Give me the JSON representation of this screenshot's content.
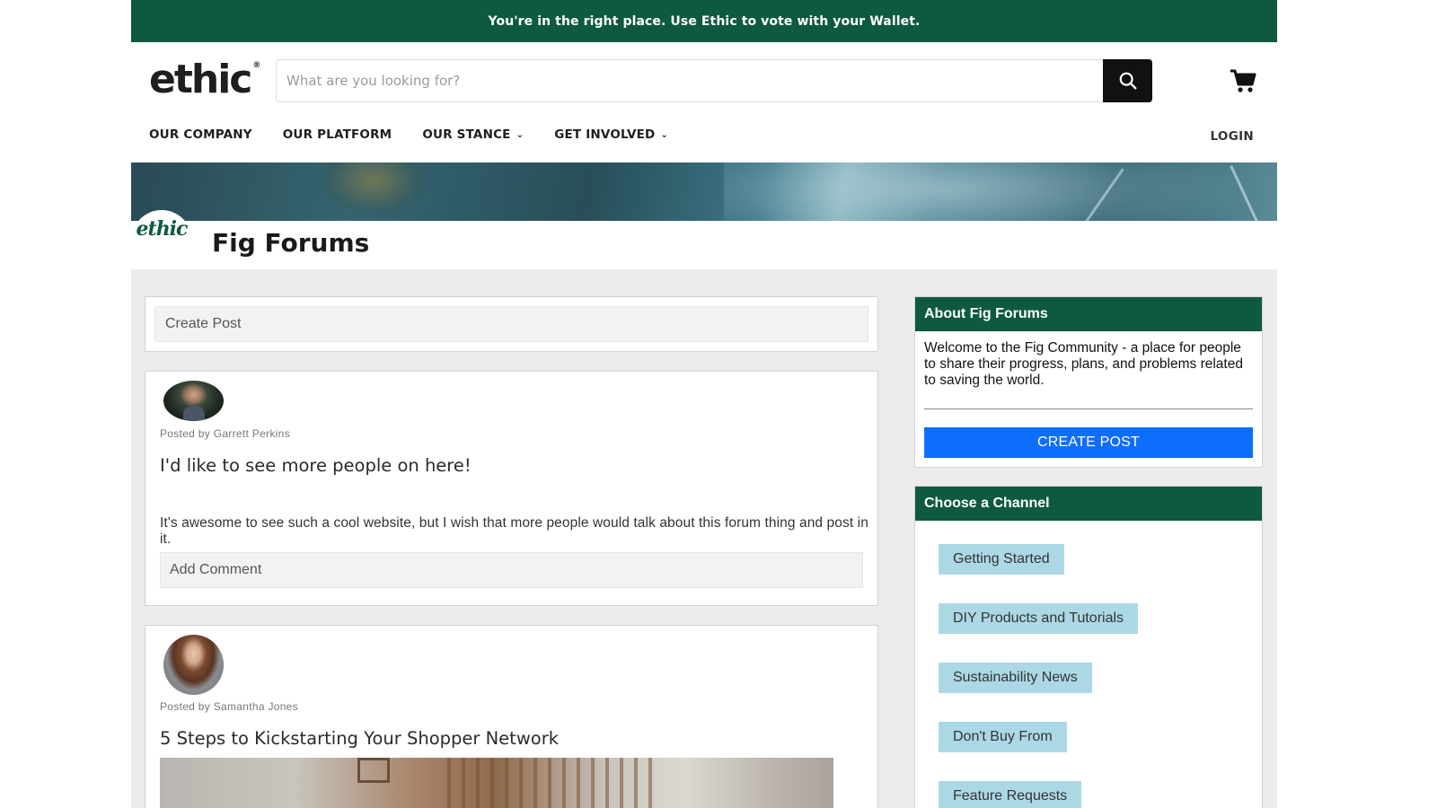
{
  "announcement": "You're in the right place. Use Ethic to vote with your Wallet.",
  "header": {
    "logo_text": "ethic",
    "logo_mark": "®",
    "search_placeholder": "What are you looking for?",
    "search_icon": "search-icon",
    "cart_icon": "cart-icon"
  },
  "nav": {
    "items": [
      {
        "label": "OUR COMPANY",
        "dropdown": false
      },
      {
        "label": "OUR PLATFORM",
        "dropdown": false
      },
      {
        "label": "OUR STANCE",
        "dropdown": true
      },
      {
        "label": "GET INVOLVED",
        "dropdown": true
      }
    ],
    "chevron": "⌄",
    "login": "LOGIN"
  },
  "forum": {
    "badge_text": "ethic",
    "title": "Fig Forums"
  },
  "create_post": {
    "placeholder": "Create Post"
  },
  "posts": [
    {
      "posted_by": "Posted by Garrett Perkins",
      "title": "I'd like to see more people on here!",
      "body": "It's awesome to see such a cool website, but I wish that more people would talk about this forum thing and post in it.",
      "comment_placeholder": "Add Comment"
    },
    {
      "posted_by": "Posted by Samantha Jones",
      "title": "5 Steps to Kickstarting Your Shopper Network"
    }
  ],
  "sidebar": {
    "about": {
      "heading": "About Fig Forums",
      "text": "Welcome to the Fig Community - a place for people to share their progress, plans, and problems related to saving the world.",
      "button": "CREATE POST"
    },
    "channels": {
      "heading": "Choose a Channel",
      "items": [
        "Getting Started",
        "DIY Products and Tutorials",
        "Sustainability News",
        "Don't Buy From",
        "Feature Requests"
      ]
    }
  },
  "colors": {
    "brand_green": "#0e5a3f",
    "primary_blue": "#0d6efd",
    "channel_chip": "#acd8e6"
  }
}
